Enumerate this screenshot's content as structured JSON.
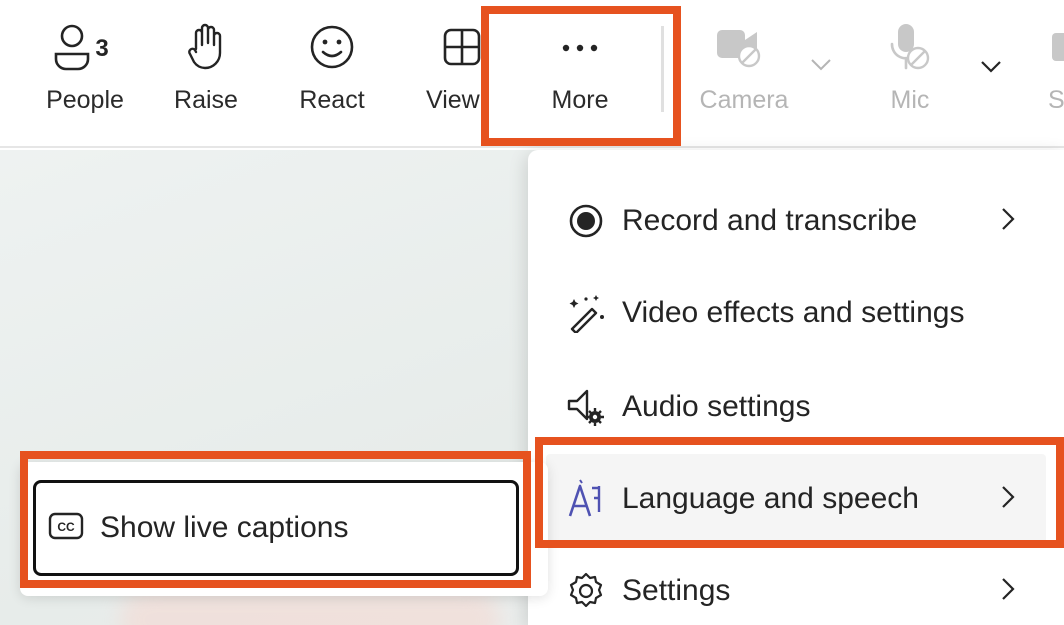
{
  "toolbar": {
    "people": {
      "label": "People",
      "count": "3",
      "icon": "people-icon"
    },
    "raise": {
      "label": "Raise",
      "icon": "raise-hand-icon"
    },
    "react": {
      "label": "React",
      "icon": "smiley-icon"
    },
    "view": {
      "label": "View",
      "icon": "grid-icon"
    },
    "more": {
      "label": "More",
      "icon": "ellipsis-icon"
    },
    "camera": {
      "label": "Camera",
      "icon": "camera-off-icon",
      "disabled": true
    },
    "mic": {
      "label": "Mic",
      "icon": "mic-off-icon",
      "disabled": true
    },
    "share": {
      "label": "S",
      "icon": "share-icon",
      "disabled": true
    }
  },
  "more_menu": {
    "items": [
      {
        "label": "Record and transcribe",
        "icon": "record-icon",
        "has_submenu": true
      },
      {
        "label": "Video effects and settings",
        "icon": "magic-wand-icon",
        "has_submenu": false
      },
      {
        "label": "Audio settings",
        "icon": "speaker-settings-icon",
        "has_submenu": false
      },
      {
        "label": "Language and speech",
        "icon": "language-icon",
        "has_submenu": true,
        "highlighted": true
      },
      {
        "label": "Settings",
        "icon": "gear-icon",
        "has_submenu": true
      }
    ]
  },
  "language_submenu": {
    "item": {
      "label": "Show live captions",
      "icon": "closed-captions-icon",
      "icon_text": "CC"
    }
  },
  "colors": {
    "callout": "#e6521f",
    "accent": "#5b5fc7",
    "disabled": "#b5b5b5"
  }
}
